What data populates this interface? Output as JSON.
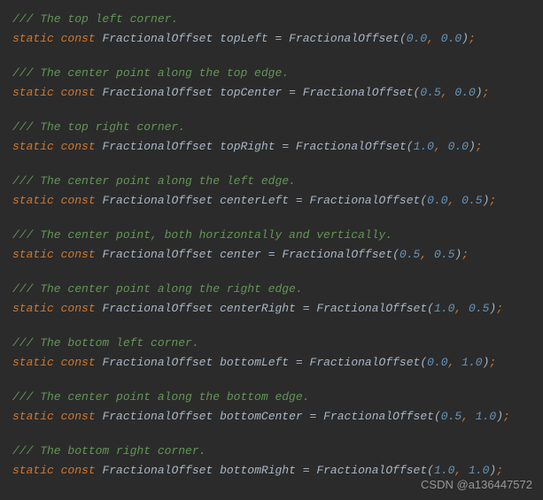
{
  "entries": [
    {
      "comment": "/// The top left corner.",
      "name": "topLeft",
      "x": "0.0",
      "y": "0.0"
    },
    {
      "comment": "/// The center point along the top edge.",
      "name": "topCenter",
      "x": "0.5",
      "y": "0.0"
    },
    {
      "comment": "/// The top right corner.",
      "name": "topRight",
      "x": "1.0",
      "y": "0.0"
    },
    {
      "comment": "/// The center point along the left edge.",
      "name": "centerLeft",
      "x": "0.0",
      "y": "0.5"
    },
    {
      "comment": "/// The center point, both horizontally and vertically.",
      "name": "center",
      "x": "0.5",
      "y": "0.5"
    },
    {
      "comment": "/// The center point along the right edge.",
      "name": "centerRight",
      "x": "1.0",
      "y": "0.5"
    },
    {
      "comment": "/// The bottom left corner.",
      "name": "bottomLeft",
      "x": "0.0",
      "y": "1.0"
    },
    {
      "comment": "/// The center point along the bottom edge.",
      "name": "bottomCenter",
      "x": "0.5",
      "y": "1.0"
    },
    {
      "comment": "/// The bottom right corner.",
      "name": "bottomRight",
      "x": "1.0",
      "y": "1.0"
    }
  ],
  "keywords": {
    "static": "static",
    "const": "const"
  },
  "typeName": "FractionalOffset",
  "className": "FractionalOffset",
  "watermark": "CSDN @a136447572"
}
